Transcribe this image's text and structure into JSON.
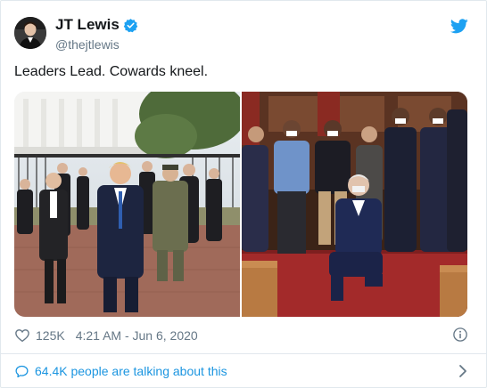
{
  "user": {
    "name": "JT Lewis",
    "handle": "@thejtlewis",
    "avatar_icon": "profile-photo-icon"
  },
  "tweet": {
    "text": "Leaders Lead. Cowards kneel."
  },
  "media": {
    "photos": [
      "photo-walking-group-street",
      "photo-kneeling-group-church"
    ]
  },
  "stats": {
    "likes": "125K",
    "timestamp": "4:21 AM - Jun 6, 2020"
  },
  "conversation": {
    "label": "64.4K people are talking about this"
  },
  "colors": {
    "accent": "#1da1f2",
    "link": "#1b95e0",
    "muted": "#657786"
  },
  "icons": {
    "verified": "verified-badge-icon",
    "platform": "twitter-bird-icon",
    "like": "heart-icon",
    "info": "info-icon",
    "talk": "speech-bubble-icon",
    "more": "chevron-right-icon"
  }
}
